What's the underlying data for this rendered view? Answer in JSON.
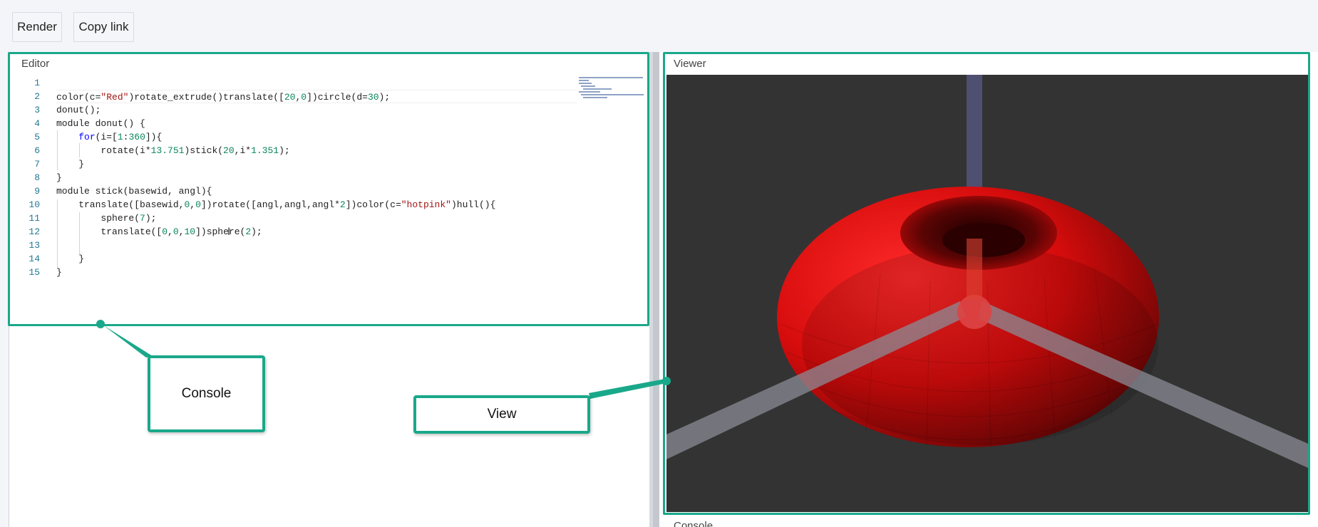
{
  "toolbar": {
    "render_label": "Render",
    "copy_link_label": "Copy link"
  },
  "editor": {
    "title": "Editor",
    "line_numbers": [
      "1",
      "2",
      "3",
      "4",
      "5",
      "6",
      "7",
      "8",
      "9",
      "10",
      "11",
      "12",
      "13",
      "14",
      "15"
    ],
    "lines": [
      "",
      "color(c=\"Red\")rotate_extrude()translate([20,0])circle(d=30);",
      "donut();",
      "module donut() {",
      "    for(i=[1:360]){",
      "        rotate(i*13.751)stick(20,i*1.351);",
      "    }",
      "}",
      "module stick(basewid, angl){",
      "    translate([basewid,0,0])rotate([angl,angl,angl*2])color(c=\"hotpink\")hull(){",
      "        sphere(7);",
      "        translate([0,0,10])sphere(2);",
      "",
      "    }",
      "}"
    ]
  },
  "viewer": {
    "title": "Viewer",
    "model_color": "#e01010",
    "background_color": "#333333"
  },
  "console": {
    "title": "Console"
  },
  "annotations": {
    "console_label": "Console",
    "view_label": "View",
    "accent_color": "#1aa88a"
  },
  "icons": {
    "text_cursor": "i-beam-cursor-icon"
  }
}
